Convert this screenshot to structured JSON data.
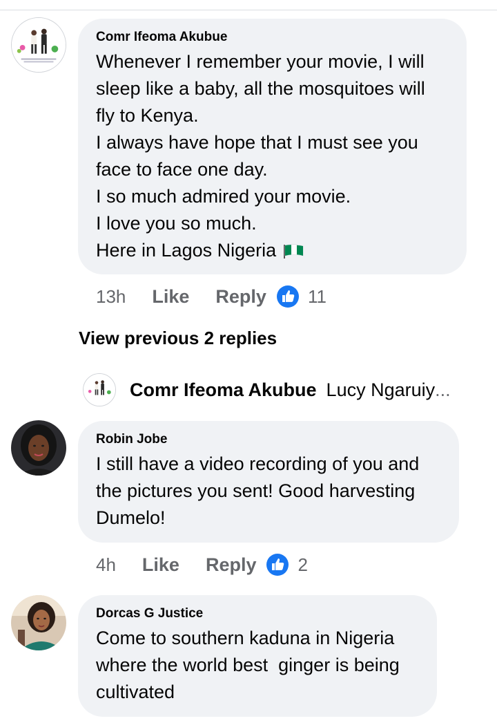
{
  "comments": [
    {
      "author": "Comr Ifeoma Akubue",
      "lines": [
        "Whenever I remember your movie, I will",
        "sleep like a baby, all the mosquitoes will",
        "fly to Kenya.",
        "I always have hope that I must see you",
        "face to face one day.",
        "I so much admired your movie.",
        "I love you so much.",
        "Here in Lagos Nigeria"
      ],
      "flag_icon": "nigeria-flag-emoji",
      "time": "13h",
      "like_label": "Like",
      "reply_label": "Reply",
      "reaction_count": "11"
    },
    {
      "author": "Robin Jobe",
      "lines": [
        "I still have a video recording of you and",
        "the pictures you sent! Good harvesting",
        "Dumelo!"
      ],
      "time": "4h",
      "like_label": "Like",
      "reply_label": "Reply",
      "reaction_count": "2"
    },
    {
      "author": "Dorcas G Justice",
      "lines": [
        "Come to southern kaduna in Nigeria",
        "where the world best  ginger is being",
        "cultivated"
      ]
    }
  ],
  "view_previous": "View previous 2 replies",
  "reply_preview": {
    "author": "Comr Ifeoma Akubue",
    "text": "Lucy Ngaruiy",
    "ellipsis": "..."
  },
  "colors": {
    "bubble": "#f0f2f5",
    "meta_text": "#65676b",
    "like_blue": "#1877f2",
    "divider": "#dadde1"
  }
}
